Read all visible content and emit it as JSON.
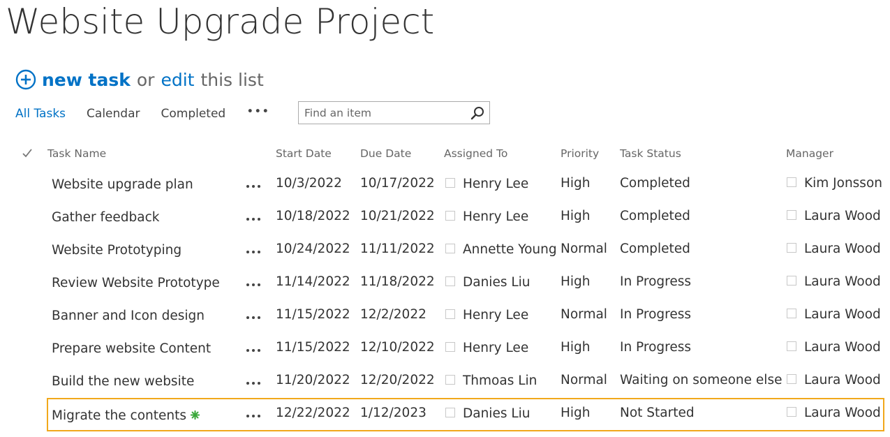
{
  "page_title": "Website Upgrade Project",
  "actions": {
    "new_task_label": "new task",
    "or_label": "or",
    "edit_label": "edit",
    "this_list_label": "this list"
  },
  "views": {
    "all_tasks": "All Tasks",
    "calendar": "Calendar",
    "completed": "Completed",
    "more": "•••"
  },
  "search": {
    "placeholder": "Find an item",
    "value": ""
  },
  "columns": {
    "task_name": "Task Name",
    "start_date": "Start Date",
    "due_date": "Due Date",
    "assigned_to": "Assigned To",
    "priority": "Priority",
    "task_status": "Task Status",
    "manager": "Manager"
  },
  "rows": [
    {
      "task": "Website upgrade plan",
      "start": "10/3/2022",
      "due": "10/17/2022",
      "assigned": "Henry Lee",
      "priority": "High",
      "status": "Completed",
      "manager": "Kim Jonsson"
    },
    {
      "task": "Gather feedback",
      "start": "10/18/2022",
      "due": "10/21/2022",
      "assigned": "Henry Lee",
      "priority": "High",
      "status": "Completed",
      "manager": "Laura Wood"
    },
    {
      "task": "Website Prototyping",
      "start": "10/24/2022",
      "due": "11/11/2022",
      "assigned": "Annette Young",
      "priority": "Normal",
      "status": "Completed",
      "manager": "Laura Wood"
    },
    {
      "task": "Review Website Prototype",
      "start": "11/14/2022",
      "due": "11/18/2022",
      "assigned": "Danies Liu",
      "priority": "High",
      "status": "In Progress",
      "manager": "Laura Wood"
    },
    {
      "task": "Banner and Icon design",
      "start": "11/15/2022",
      "due": "12/2/2022",
      "assigned": "Henry Lee",
      "priority": "Normal",
      "status": "In Progress",
      "manager": "Laura Wood"
    },
    {
      "task": "Prepare website Content",
      "start": "11/15/2022",
      "due": "12/10/2022",
      "assigned": "Henry Lee",
      "priority": "High",
      "status": "In Progress",
      "manager": "Laura Wood"
    },
    {
      "task": "Build the new website",
      "start": "11/20/2022",
      "due": "12/20/2022",
      "assigned": "Thmoas Lin",
      "priority": "Normal",
      "status": "Waiting on someone else",
      "manager": "Laura Wood"
    },
    {
      "task": "Migrate the contents",
      "start": "12/22/2022",
      "due": "1/12/2023",
      "assigned": "Danies Liu",
      "priority": "High",
      "status": "Not Started",
      "manager": "Laura Wood"
    }
  ],
  "colors": {
    "link": "#0072c6",
    "highlight": "#f1a81b",
    "new_badge": "#3aa83a"
  }
}
